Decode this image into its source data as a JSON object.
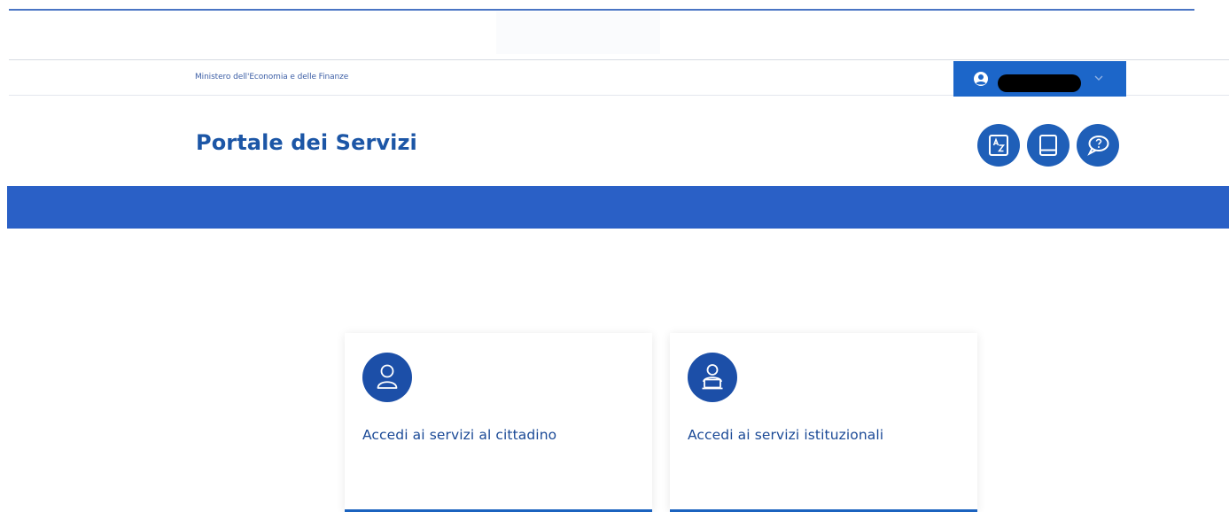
{
  "header": {
    "ministry": "Ministero dell'Economia e delle Finanze",
    "title": "Portale dei Servizi",
    "user_menu": {
      "username": "",
      "icon": "user-circle-icon",
      "chevron": "chevron-down-icon"
    },
    "toolbar": [
      {
        "name": "az-index-icon"
      },
      {
        "name": "book-icon"
      },
      {
        "name": "help-chat-icon"
      }
    ]
  },
  "cards": [
    {
      "label": "Accedi ai servizi al cittadino",
      "icon": "person-icon"
    },
    {
      "label": "Accedi ai servizi istituzionali",
      "icon": "person-laptop-icon"
    }
  ],
  "colors": {
    "primary": "#1c66c9",
    "band": "#2a60c6",
    "title": "#1c56a6",
    "icon_circle": "#1c4fa8"
  }
}
